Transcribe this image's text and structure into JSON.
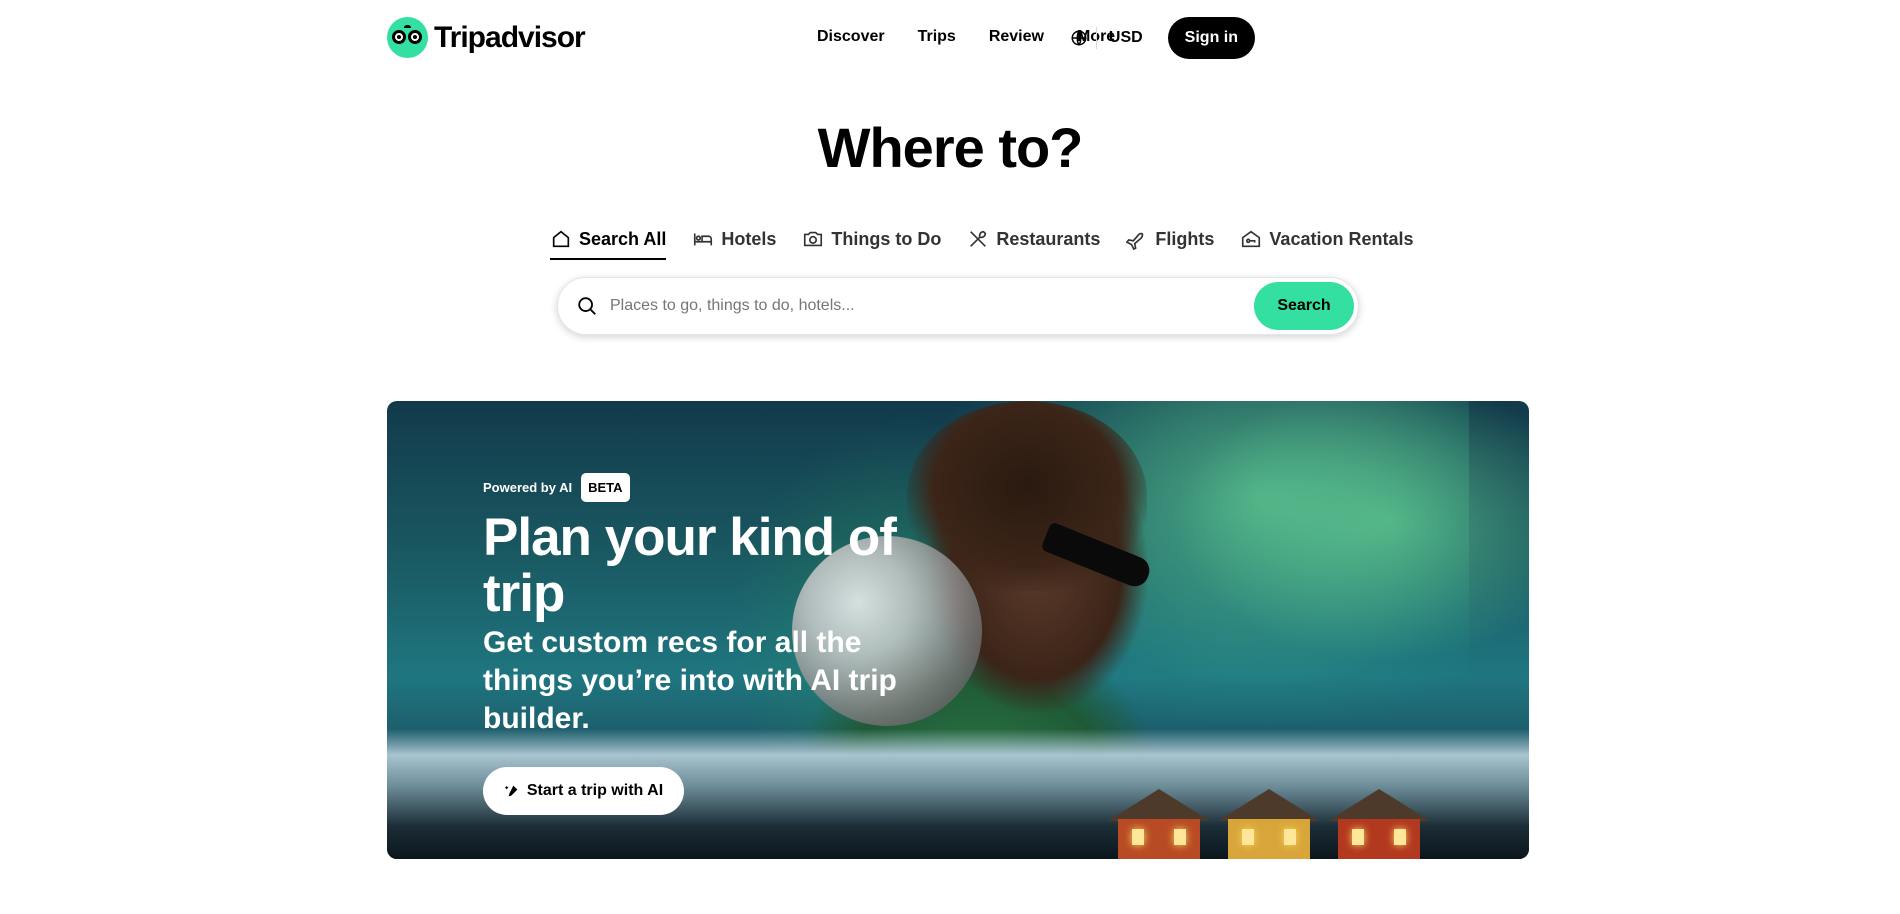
{
  "header": {
    "logo_text": "Tripadvisor",
    "nav": [
      "Discover",
      "Trips",
      "Review",
      "More"
    ],
    "currency": "USD",
    "signin_label": "Sign in"
  },
  "hero": {
    "headline": "Where to?",
    "tabs": [
      {
        "label": "Search All",
        "icon": "home-icon",
        "active": true
      },
      {
        "label": "Hotels",
        "icon": "bed-icon"
      },
      {
        "label": "Things to Do",
        "icon": "camera-icon"
      },
      {
        "label": "Restaurants",
        "icon": "utensils-icon"
      },
      {
        "label": "Flights",
        "icon": "plane-icon"
      },
      {
        "label": "Vacation Rentals",
        "icon": "house-key-icon"
      }
    ],
    "search": {
      "placeholder": "Places to go, things to do, hotels...",
      "button_label": "Search"
    }
  },
  "banner": {
    "powered_by": "Powered by AI",
    "badge": "BETA",
    "title": "Plan your kind of trip",
    "subtitle": "Get custom recs for all the things you’re into with AI trip builder.",
    "cta_label": "Start a trip with AI"
  },
  "colors": {
    "brand_green": "#34e0a1",
    "black": "#000000"
  }
}
